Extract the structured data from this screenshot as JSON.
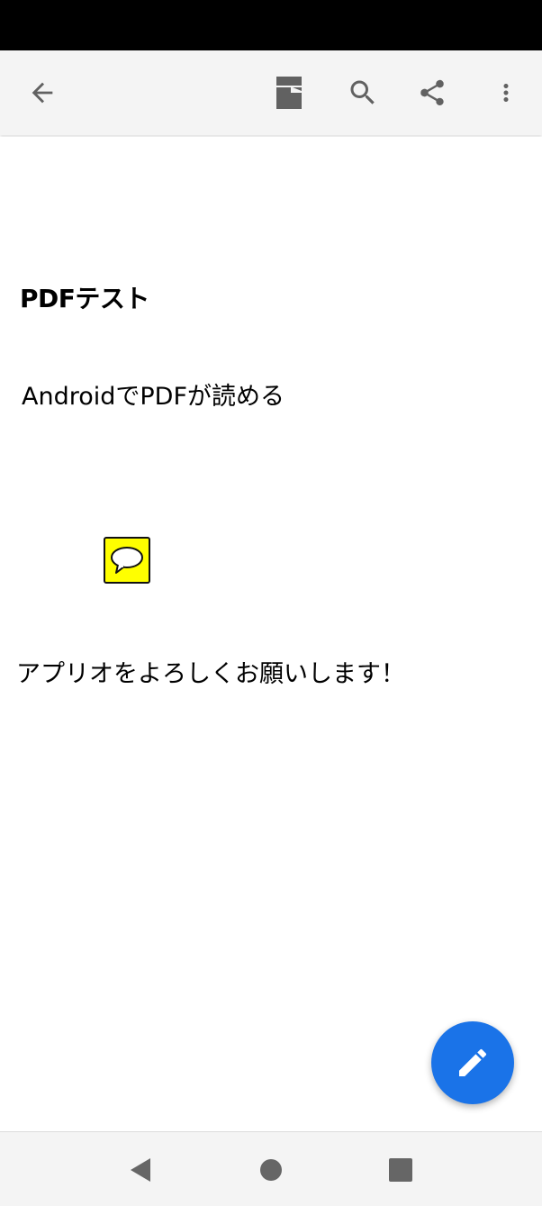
{
  "app": {
    "toolbar": {
      "icons": [
        "back-arrow-icon",
        "annotation-icon",
        "search-icon",
        "share-icon",
        "more-vert-icon"
      ],
      "icon_color": "#616161"
    }
  },
  "document": {
    "title": "PDFテスト",
    "line1": "AndroidでPDFが読める",
    "comment_annotation_color": "#ffff00",
    "line2": "アプリオをよろしくお願いします！"
  },
  "fab": {
    "icon": "pencil-icon",
    "color": "#1a73e8"
  },
  "system_nav": {
    "buttons": [
      "back-triangle-icon",
      "home-circle-icon",
      "recents-square-icon"
    ]
  }
}
